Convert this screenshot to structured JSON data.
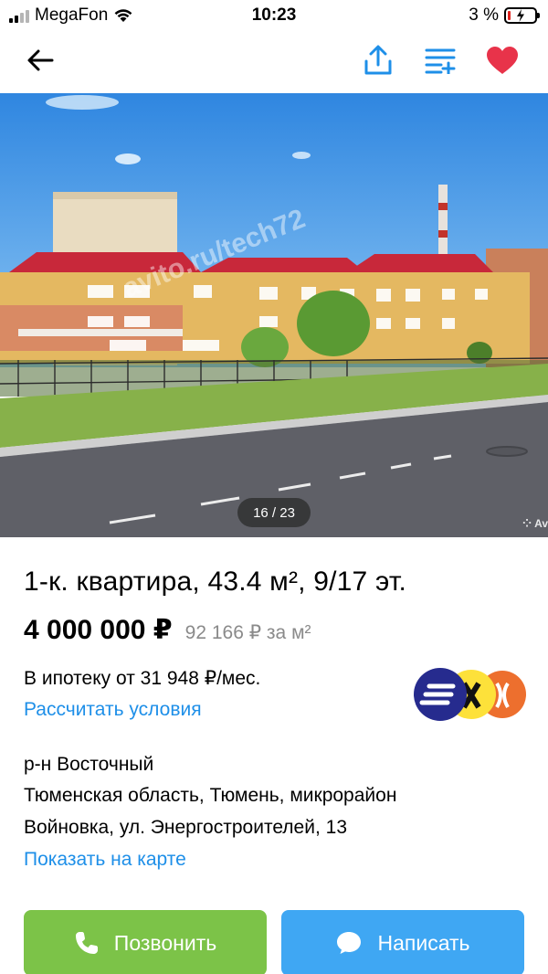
{
  "status_bar": {
    "carrier": "MegaFon",
    "time": "10:23",
    "battery": "3 %"
  },
  "nav": {
    "back_icon": "arrow-left-icon",
    "share_icon": "share-icon",
    "compare_icon": "compare-list-icon",
    "favorite_icon": "heart-icon",
    "accent": "#1e8fe8",
    "favorite_color": "#e8334a"
  },
  "gallery": {
    "counter": "16 / 23",
    "watermark": "avito.ru/tech72",
    "corner_mark": "Av"
  },
  "listing": {
    "title": "1-к. квартира, 43.4 м², 9/17 эт.",
    "price": "4 000 000 ₽",
    "price_per_m2": "92 166 ₽ за м²",
    "mortgage_text": "В ипотеку от 31 948 ₽/мес.",
    "mortgage_link": "Рассчитать условия",
    "district": "р-н Восточный",
    "address_line1": "Тюменская область, Тюмень, микрорайон",
    "address_line2": "Войновка, ул. Энергостроителей, 13",
    "map_link": "Показать на карте"
  },
  "actions": {
    "call_label": "Позвонить",
    "message_label": "Написать",
    "call_color": "#7cc348",
    "message_color": "#3fa7f3"
  }
}
